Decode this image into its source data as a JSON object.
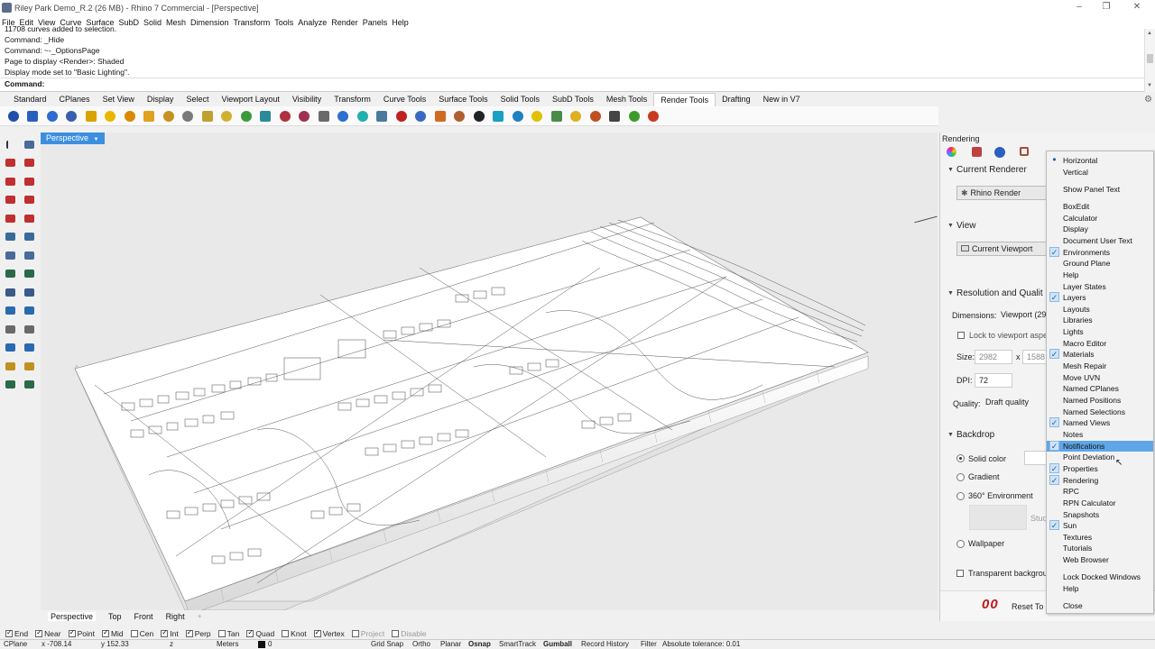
{
  "window": {
    "title": "Riley Park Demo_R.2 (26 MB) - Rhino 7 Commercial - [Perspective]",
    "controls": [
      "–",
      "❐",
      "✕"
    ]
  },
  "menu": [
    "File",
    "Edit",
    "View",
    "Curve",
    "Surface",
    "SubD",
    "Solid",
    "Mesh",
    "Dimension",
    "Transform",
    "Tools",
    "Analyze",
    "Render",
    "Panels",
    "Help"
  ],
  "command_history": [
    "11708 curves added to selection.",
    "Command: _Hide",
    "Command: ~-_OptionsPage",
    "Page to display <Render>: Shaded",
    "Display mode set to \"Basic Lighting\".",
    "Command:"
  ],
  "tabs": [
    "Standard",
    "CPlanes",
    "Set View",
    "Display",
    "Select",
    "Viewport Layout",
    "Visibility",
    "Transform",
    "Curve Tools",
    "Surface Tools",
    "Solid Tools",
    "SubD Tools",
    "Mesh Tools",
    "Render Tools",
    "Drafting",
    "New in V7"
  ],
  "active_tab": "Render Tools",
  "toolbar_icons": [
    {
      "name": "render-icon",
      "color": "#1f4fa8"
    },
    {
      "name": "render-window-icon",
      "color": "#2a5fc0"
    },
    {
      "name": "render-preview-icon",
      "color": "#2e6bd0"
    },
    {
      "name": "raytraced-icon",
      "color": "#3a5fb0"
    },
    {
      "name": "spotlight-icon",
      "color": "#d9a400"
    },
    {
      "name": "point-light-icon",
      "color": "#e8b800"
    },
    {
      "name": "directional-light-icon",
      "color": "#d98a00"
    },
    {
      "name": "rectangular-light-icon",
      "color": "#e0a020"
    },
    {
      "name": "linear-light-icon",
      "color": "#c89020"
    },
    {
      "name": "sun-icon",
      "color": "#7a7a7a"
    },
    {
      "name": "edit-light-icon",
      "color": "#c0a030"
    },
    {
      "name": "light-properties-icon",
      "color": "#d0b030"
    },
    {
      "name": "material-sphere-icon",
      "color": "#3a9a3a"
    },
    {
      "name": "texture-icon",
      "color": "#2a8a9a"
    },
    {
      "name": "decal-icon",
      "color": "#b03040"
    },
    {
      "name": "material-library-icon",
      "color": "#a03050"
    },
    {
      "name": "lens-flare-icon",
      "color": "#6a6a6a"
    },
    {
      "name": "mapping-icon",
      "color": "#2b6fd0"
    },
    {
      "name": "cube-mapping-icon",
      "color": "#1fb0b0"
    },
    {
      "name": "ground-plane-icon",
      "color": "#4a7a9a"
    },
    {
      "name": "environment-icon",
      "color": "#c02020"
    },
    {
      "name": "turntable-icon",
      "color": "#3a6ac0"
    },
    {
      "name": "basketball-icon",
      "color": "#d06a20"
    },
    {
      "name": "wrench-icon",
      "color": "#b06030"
    },
    {
      "name": "checker-icon",
      "color": "#222222"
    },
    {
      "name": "cloud-icon",
      "color": "#1aa0c0"
    },
    {
      "name": "globe-icon",
      "color": "#2080c0"
    },
    {
      "name": "dimension-icon",
      "color": "#e0c000"
    },
    {
      "name": "layout-icon",
      "color": "#4a8a4a"
    },
    {
      "name": "folder-icon",
      "color": "#e0b020"
    },
    {
      "name": "gear-icon",
      "color": "#c05020"
    },
    {
      "name": "screen-icon",
      "color": "#444444"
    },
    {
      "name": "play-icon",
      "color": "#3a9a2a"
    },
    {
      "name": "record-icon",
      "color": "#c83a20"
    }
  ],
  "viewport": {
    "title": "Perspective",
    "tabs": [
      "Perspective",
      "Top",
      "Front",
      "Right"
    ],
    "active_tab": "Perspective"
  },
  "osnap": [
    {
      "label": "End",
      "on": true
    },
    {
      "label": "Near",
      "on": true
    },
    {
      "label": "Point",
      "on": true
    },
    {
      "label": "Mid",
      "on": true
    },
    {
      "label": "Cen",
      "on": false
    },
    {
      "label": "Int",
      "on": true
    },
    {
      "label": "Perp",
      "on": true
    },
    {
      "label": "Tan",
      "on": false
    },
    {
      "label": "Quad",
      "on": true
    },
    {
      "label": "Knot",
      "on": false
    },
    {
      "label": "Vertex",
      "on": true
    },
    {
      "label": "Project",
      "on": false
    },
    {
      "label": "Disable",
      "on": false
    }
  ],
  "status": {
    "cplane": "CPlane",
    "x": "x -708.14",
    "y": "y 152.33",
    "z": "z",
    "units": "Meters",
    "layer": "0",
    "grid_snap": "Grid Snap",
    "ortho": "Ortho",
    "planar": "Planar",
    "osnap": "Osnap",
    "smarttrack": "SmartTrack",
    "gumball": "Gumball",
    "record_history": "Record History",
    "filter": "Filter",
    "tolerance": "Absolute tolerance: 0.01"
  },
  "rendering_panel": {
    "title": "Rendering",
    "current_renderer_heading": "Current Renderer",
    "renderer": "Rhino Render",
    "view_heading": "View",
    "view_value": "Current Viewport",
    "resolution_heading": "Resolution and Qualit",
    "dimensions_label": "Dimensions:",
    "dimensions_value": "Viewport (29",
    "lock_aspect": "Lock to viewport aspe",
    "size_label": "Size:",
    "size_w": "2982",
    "size_x": "x",
    "size_h": "1588",
    "dpi_label": "DPI:",
    "dpi_value": "72",
    "quality_label": "Quality:",
    "quality_value": "Draft quality",
    "backdrop_heading": "Backdrop",
    "solid_color": "Solid color",
    "gradient": "Gradient",
    "env360": "360° Environment",
    "studio_label": "Stud",
    "wallpaper": "Wallpaper",
    "transparent_bg": "Transparent backgrou",
    "reset": "Reset To D",
    "digits": "00"
  },
  "context_menu": {
    "items": [
      {
        "label": "Horizontal",
        "check": "dot"
      },
      {
        "label": "Vertical",
        "check": ""
      },
      {
        "label": "",
        "check": "sep"
      },
      {
        "label": "Show Panel Text",
        "check": ""
      },
      {
        "label": "",
        "check": "sep"
      },
      {
        "label": "BoxEdit",
        "check": ""
      },
      {
        "label": "Calculator",
        "check": ""
      },
      {
        "label": "Display",
        "check": ""
      },
      {
        "label": "Document User Text",
        "check": ""
      },
      {
        "label": "Environments",
        "check": "yes"
      },
      {
        "label": "Ground Plane",
        "check": ""
      },
      {
        "label": "Help",
        "check": ""
      },
      {
        "label": "Layer States",
        "check": ""
      },
      {
        "label": "Layers",
        "check": "yes"
      },
      {
        "label": "Layouts",
        "check": ""
      },
      {
        "label": "Libraries",
        "check": ""
      },
      {
        "label": "Lights",
        "check": ""
      },
      {
        "label": "Macro Editor",
        "check": ""
      },
      {
        "label": "Materials",
        "check": "yes"
      },
      {
        "label": "Mesh Repair",
        "check": ""
      },
      {
        "label": "Move UVN",
        "check": ""
      },
      {
        "label": "Named CPlanes",
        "check": ""
      },
      {
        "label": "Named Positions",
        "check": ""
      },
      {
        "label": "Named Selections",
        "check": ""
      },
      {
        "label": "Named Views",
        "check": "yes"
      },
      {
        "label": "Notes",
        "check": ""
      },
      {
        "label": "Notifications",
        "check": "yes",
        "highlight": true
      },
      {
        "label": "Point Deviation",
        "check": ""
      },
      {
        "label": "Properties",
        "check": "yes"
      },
      {
        "label": "Rendering",
        "check": "yes"
      },
      {
        "label": "RPC",
        "check": ""
      },
      {
        "label": "RPN Calculator",
        "check": ""
      },
      {
        "label": "Snapshots",
        "check": ""
      },
      {
        "label": "Sun",
        "check": "yes"
      },
      {
        "label": "Textures",
        "check": ""
      },
      {
        "label": "Tutorials",
        "check": ""
      },
      {
        "label": "Web Browser",
        "check": ""
      },
      {
        "label": "",
        "check": "sep"
      },
      {
        "label": "Lock Docked Windows",
        "check": ""
      },
      {
        "label": "Help",
        "check": ""
      },
      {
        "label": "",
        "check": "sep"
      },
      {
        "label": "Close",
        "check": ""
      }
    ]
  }
}
